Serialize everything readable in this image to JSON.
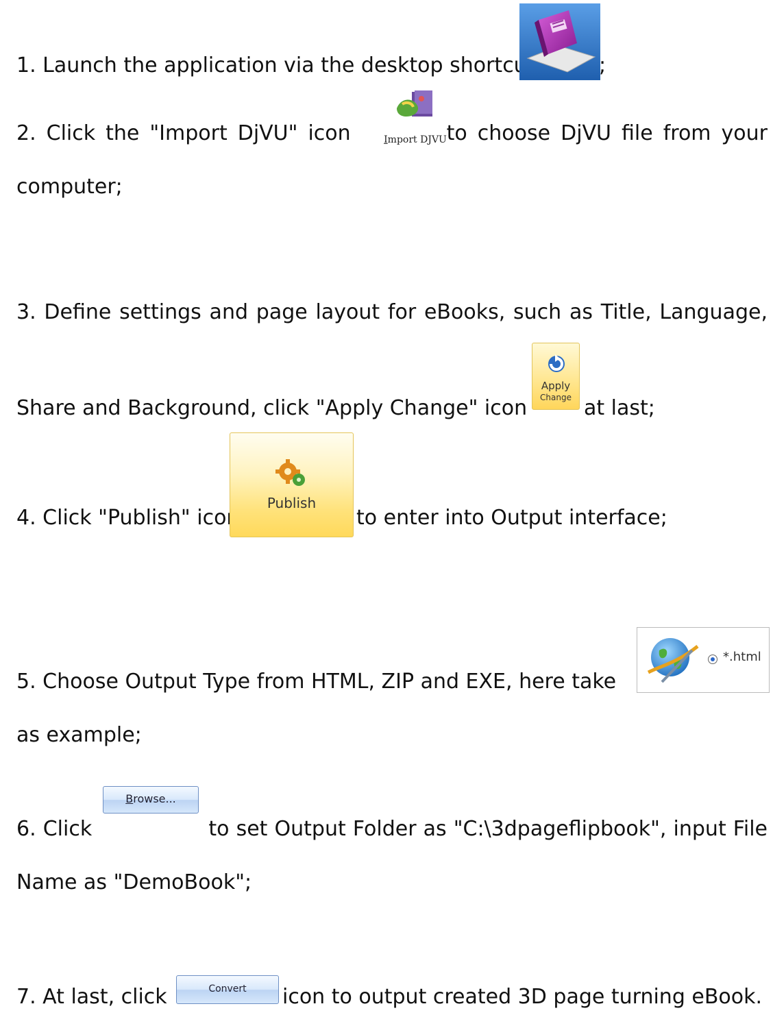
{
  "steps": {
    "s1": {
      "text": "1. Launch the application via the desktop shortcut",
      "suffix": ";"
    },
    "s2": {
      "before": "2. Click the \"Import DjVU\" icon",
      "after": "to choose DjVU file from your",
      "line2": "computer;"
    },
    "s3": {
      "line1": "3. Define settings and page layout for eBooks, such as Title, Language,",
      "before": "Share and Background, click \"Apply Change\" icon",
      "after": "at last;"
    },
    "s4": {
      "before": "4. Click \"Publish\" icon",
      "after": "to enter into Output interface;"
    },
    "s5": {
      "before": "5. Choose Output Type from HTML, ZIP and EXE, here take",
      "line2": "as example;"
    },
    "s6": {
      "before": "6. Click",
      "after": "to set Output Folder as \"C:\\3dpageflipbook\", input File",
      "line2": "Name as \"DemoBook\";"
    },
    "s7": {
      "before": "7. At last, click",
      "after": "icon to output created 3D page turning eBook."
    }
  },
  "buttons": {
    "import_first": "I",
    "import_rest": "mport DJVU",
    "apply_line1": "Apply",
    "apply_line2": "Change",
    "publish": "Publish",
    "html_option": "*.html",
    "browse_first": "B",
    "browse_rest": "rowse...",
    "convert": "Convert"
  },
  "icons": [
    "book-icon",
    "import-djvu-icon",
    "apply-change-icon",
    "publish-gears-icon",
    "globe-icon"
  ]
}
